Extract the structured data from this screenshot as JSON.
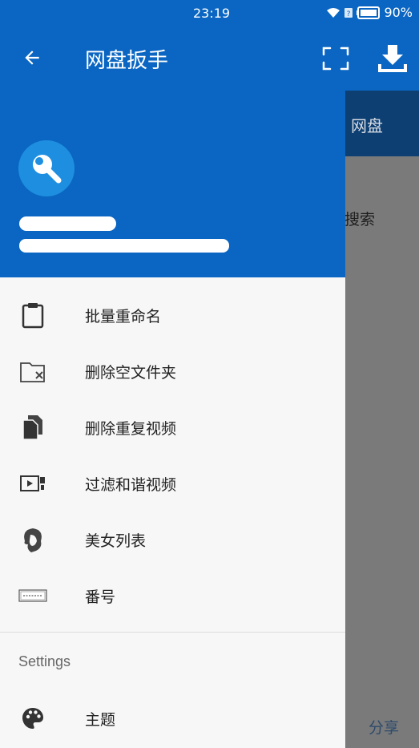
{
  "status_bar": {
    "time": "23:19",
    "battery": "90%"
  },
  "app_bar": {
    "title": "网盘扳手"
  },
  "background_app": {
    "tab_label": "网盘",
    "search_label": "搜索",
    "share_label": "分享"
  },
  "drawer": {
    "menu_items": [
      {
        "label": "批量重命名",
        "icon": "clipboard-icon"
      },
      {
        "label": "删除空文件夹",
        "icon": "folder-delete-icon"
      },
      {
        "label": "删除重复视频",
        "icon": "duplicate-files-icon"
      },
      {
        "label": "过滤和谐视频",
        "icon": "video-filter-icon"
      },
      {
        "label": "美女列表",
        "icon": "woman-icon"
      },
      {
        "label": "番号",
        "icon": "license-plate-icon"
      }
    ],
    "settings_section": {
      "title": "Settings",
      "theme_label": "主题",
      "theme_icon": "palette-icon"
    }
  },
  "colors": {
    "primary": "#0a66c2",
    "drawer_bg": "#f7f7f7",
    "avatar": "#1e8fe0"
  }
}
